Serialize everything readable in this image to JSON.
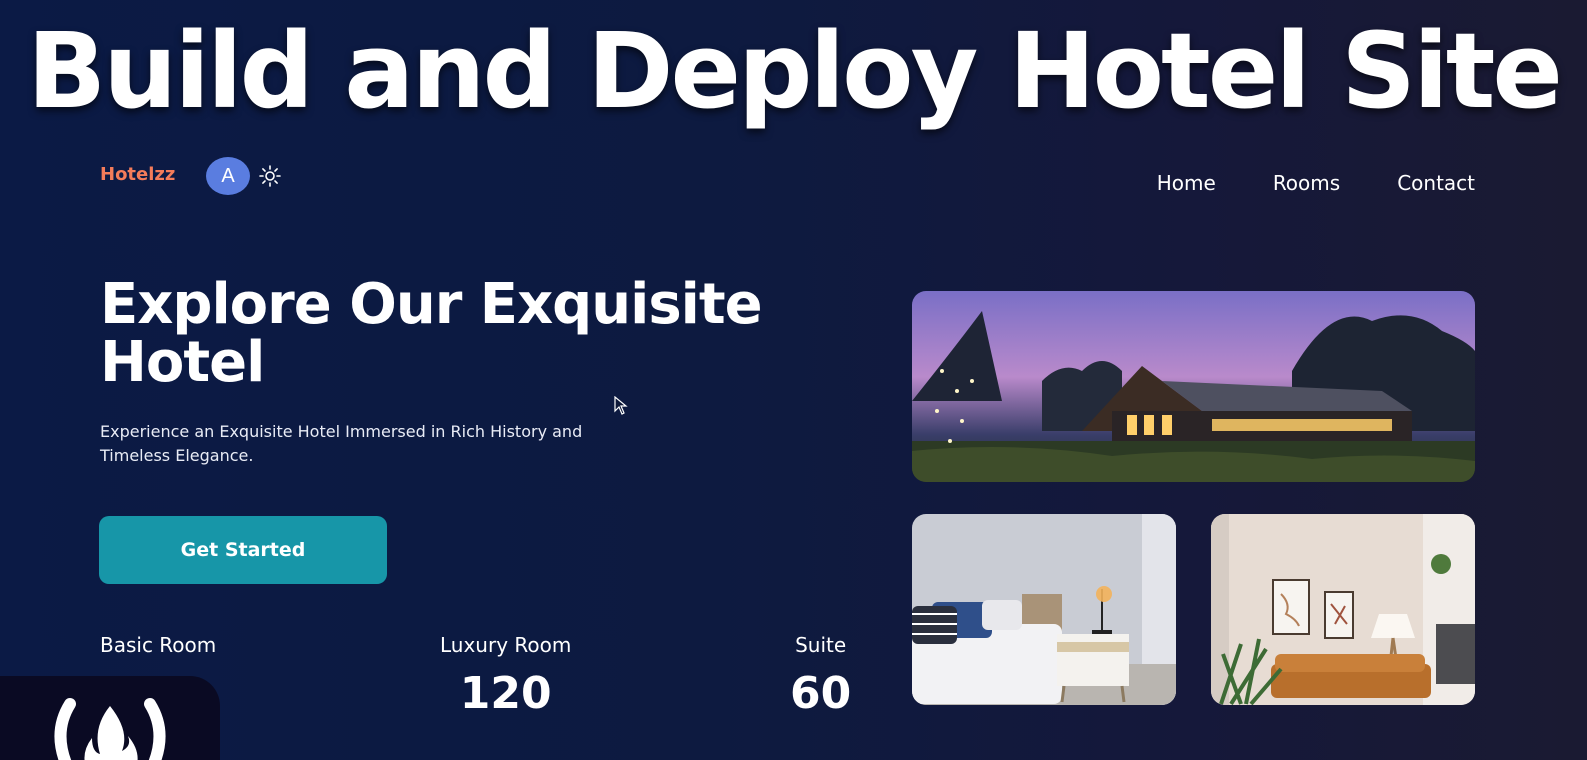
{
  "video_title": "Build and Deploy Hotel Site",
  "header": {
    "brand": "Hotelzz",
    "avatar_letter": "A",
    "theme_icon": "sun-icon",
    "nav": [
      {
        "label": "Home"
      },
      {
        "label": "Rooms"
      },
      {
        "label": "Contact"
      }
    ]
  },
  "hero": {
    "title_line1": "Explore Our Exquisite",
    "title_line2": "Hotel",
    "subtitle_line1": "Experience an Exquisite Hotel Immersed in Rich History and",
    "subtitle_line2": "Timeless Elegance.",
    "cta_label": "Get Started"
  },
  "stats": [
    {
      "label": "Basic Room",
      "value": ""
    },
    {
      "label": "Luxury Room",
      "value": "120"
    },
    {
      "label": "Suite",
      "value": "60"
    }
  ],
  "images": {
    "top": "hotel-exterior-dusk",
    "bottom_left": "bedroom-interior",
    "bottom_right": "living-room-interior"
  },
  "overlay_logo": "freecodecamp-logo",
  "colors": {
    "brand": "#f47c5a",
    "accent": "#1796a8",
    "avatar": "#5a7de0",
    "background": "#0d1838"
  }
}
